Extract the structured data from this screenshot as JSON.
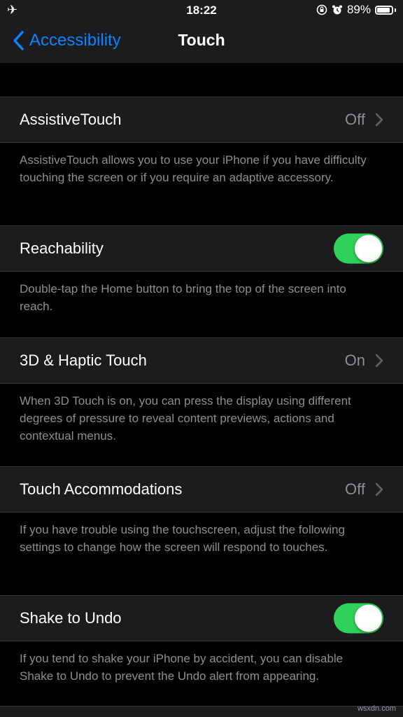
{
  "status": {
    "left_icon": "airplane-icon",
    "time": "18:22",
    "battery_percent": "89%",
    "battery_level": 0.89
  },
  "nav": {
    "back_label": "Accessibility",
    "title": "Touch"
  },
  "rows": [
    {
      "label": "AssistiveTouch",
      "value": "Off",
      "type": "disclosure",
      "footer": "AssistiveTouch allows you to use your iPhone if you have difficulty touching the screen or if you require an adaptive accessory."
    },
    {
      "label": "Reachability",
      "type": "toggle",
      "on": true,
      "footer": "Double-tap the Home button to bring the top of the screen into reach."
    },
    {
      "label": "3D & Haptic Touch",
      "value": "On",
      "type": "disclosure",
      "footer": "When 3D Touch is on, you can press the display using different degrees of pressure to reveal content previews, actions and contextual menus."
    },
    {
      "label": "Touch Accommodations",
      "value": "Off",
      "type": "disclosure",
      "footer": "If you have trouble using the touchscreen, adjust the following settings to change how the screen will respond to touches."
    },
    {
      "label": "Shake to Undo",
      "type": "toggle",
      "on": true,
      "footer": "If you tend to shake your iPhone by accident, you can disable Shake to Undo to prevent the Undo alert from appearing."
    }
  ],
  "watermark": "wsxdn.com",
  "colors": {
    "accent": "#0a84ff",
    "toggle_on": "#30d158",
    "background": "#000000",
    "cell": "#1c1c1e",
    "secondary_text": "#8e8e93"
  }
}
